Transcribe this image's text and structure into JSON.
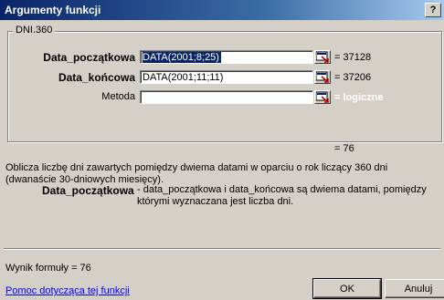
{
  "window": {
    "title": "Argumenty funkcji",
    "help": "?"
  },
  "function": {
    "name": "DNI.360",
    "args": [
      {
        "label": "Data_początkowa",
        "value": "DATA(2001;8;25)",
        "result": "= 37128"
      },
      {
        "label": "Data_końcowa",
        "value": "DATA(2001;11;11)",
        "result": "= 37206"
      },
      {
        "label": "Metoda",
        "value": "",
        "result": "= logiczne"
      }
    ],
    "result": "= 76",
    "description": "Oblicza liczbę dni zawartych pomiędzy dwiema datami w oparciu o rok liczący 360 dni (dwanaście 30-dniowych miesięcy).",
    "param_name": "Data_początkowa",
    "param_description": "- data_początkowa i data_końcowa są dwiema datami, pomiędzy którymi wyznaczana jest liczba dni."
  },
  "formula_result": "Wynik formuły =  76",
  "help_link": "Pomoc dotycząca tej funkcji",
  "buttons": {
    "ok": "OK",
    "cancel": "Anuluj"
  },
  "icons": {
    "collapse": "collapse-dialog-icon"
  }
}
